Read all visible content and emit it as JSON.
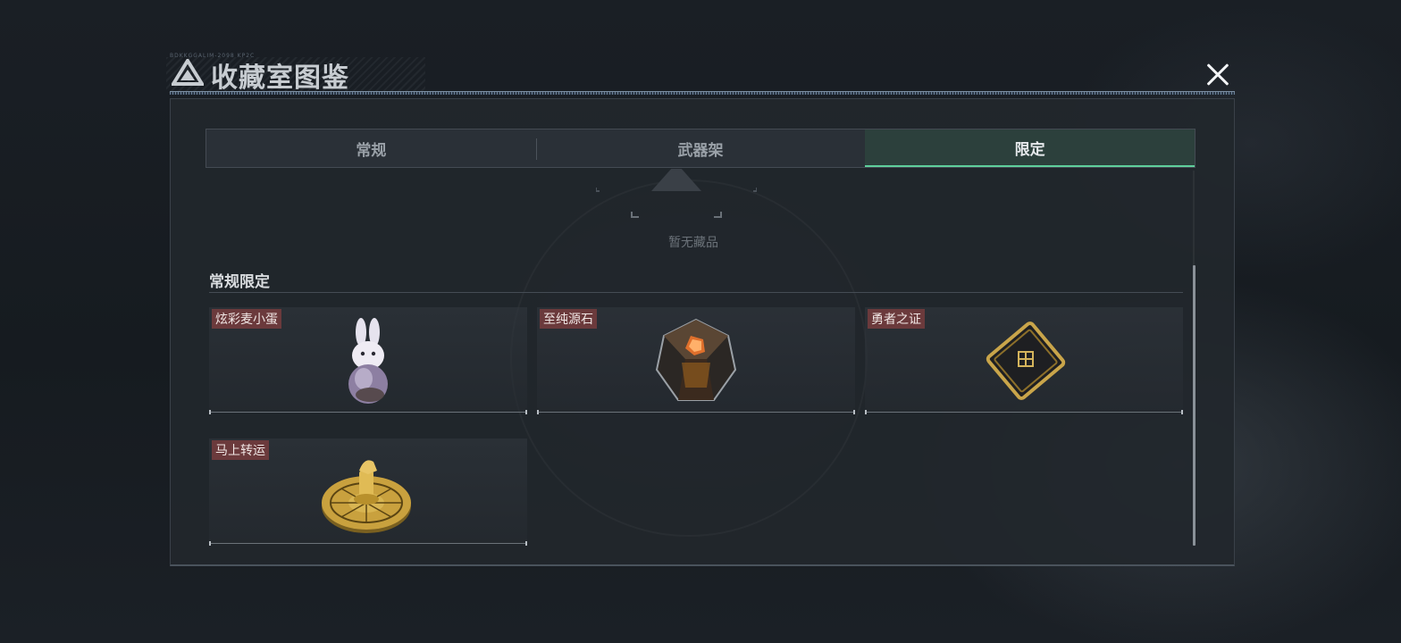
{
  "header": {
    "title": "收藏室图鉴",
    "tiny_deco": "BDKKGGALIM-2098 KP2C"
  },
  "tabs": [
    {
      "label": "常规",
      "active": false
    },
    {
      "label": "武器架",
      "active": false
    },
    {
      "label": "限定",
      "active": true
    }
  ],
  "empty_state": {
    "text": "暂无藏品"
  },
  "section": {
    "title": "常规限定",
    "items": [
      {
        "label": "炫彩麦小蛋",
        "icon": "rabbit-egg-figurine-icon"
      },
      {
        "label": "至纯源石",
        "icon": "originium-crystal-icon"
      },
      {
        "label": "勇者之证",
        "icon": "golden-card-icon"
      },
      {
        "label": "马上转运",
        "icon": "golden-horse-wheel-icon"
      }
    ]
  },
  "colors": {
    "accent": "#5fcf9c",
    "tag_bg": "#6b3a3c",
    "panel_bg": "#22272d"
  }
}
